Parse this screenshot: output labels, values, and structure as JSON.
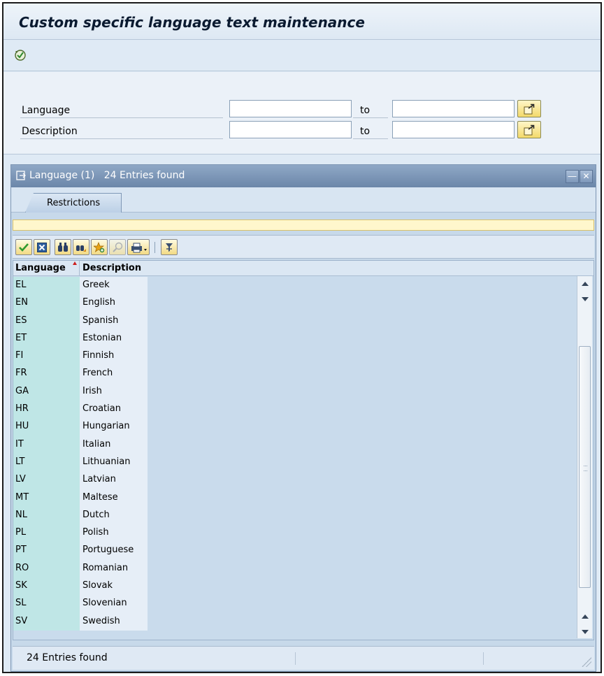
{
  "window": {
    "title": "Custom specific language text maintenance"
  },
  "toolbar": {
    "execute_icon": "execute-icon"
  },
  "selection": {
    "rows": [
      {
        "label": "Language",
        "low": "",
        "to_label": "to",
        "high": ""
      },
      {
        "label": "Description",
        "low": "",
        "to_label": "to",
        "high": ""
      }
    ]
  },
  "popup": {
    "title": "Language (1)   24 Entries found",
    "tab_label": "Restrictions",
    "toolbar_icons": [
      "check-icon",
      "cancel-icon",
      "find-icon",
      "find-next-icon",
      "new-favorite-icon",
      "help-icon",
      "print-icon",
      "filter-icon"
    ],
    "columns": [
      "Language",
      "Description"
    ],
    "rows": [
      [
        "EL",
        "Greek"
      ],
      [
        "EN",
        "English"
      ],
      [
        "ES",
        "Spanish"
      ],
      [
        "ET",
        "Estonian"
      ],
      [
        "FI",
        "Finnish"
      ],
      [
        "FR",
        "French"
      ],
      [
        "GA",
        "Irish"
      ],
      [
        "HR",
        "Croatian"
      ],
      [
        "HU",
        "Hungarian"
      ],
      [
        "IT",
        "Italian"
      ],
      [
        "LT",
        "Lithuanian"
      ],
      [
        "LV",
        "Latvian"
      ],
      [
        "MT",
        "Maltese"
      ],
      [
        "NL",
        "Dutch"
      ],
      [
        "PL",
        "Polish"
      ],
      [
        "PT",
        "Portuguese"
      ],
      [
        "RO",
        "Romanian"
      ],
      [
        "SK",
        "Slovak"
      ],
      [
        "SL",
        "Slovenian"
      ],
      [
        "SV",
        "Swedish"
      ]
    ],
    "status": "24 Entries found"
  },
  "colors": {
    "key_column": "#bfe6e6",
    "title_bar": "#6b86a9",
    "button_fill": "#f2da83"
  }
}
